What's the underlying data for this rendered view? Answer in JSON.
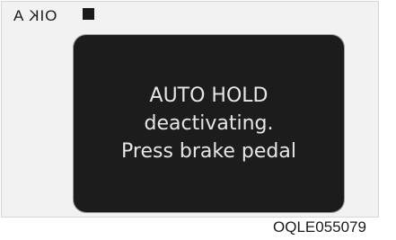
{
  "header": {
    "type_label": "OIK A"
  },
  "display": {
    "lines": [
      "AUTO HOLD",
      "deactivating.",
      "Press brake pedal"
    ]
  },
  "figure": {
    "code": "OQLE055079"
  },
  "colors": {
    "panel_bg": "#f2f2f2",
    "display_bg": "#1c1c1c",
    "display_text": "#e6e6e6",
    "marker": "#1a1a1a"
  }
}
